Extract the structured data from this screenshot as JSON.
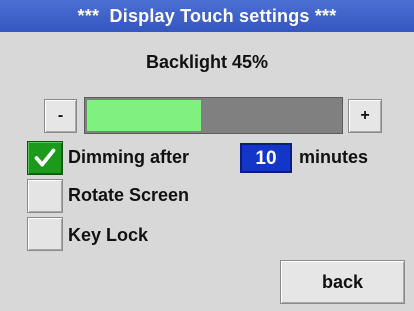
{
  "title": "***  Display Touch settings ***",
  "backlight": {
    "label": "Backlight 45%",
    "level_percent": 45,
    "minus_label": "-",
    "plus_label": "+"
  },
  "dimming": {
    "label": "Dimming after",
    "checked": true,
    "value": "10",
    "unit": "minutes"
  },
  "rotate": {
    "label": "Rotate Screen",
    "checked": false
  },
  "key_lock": {
    "label": "Key Lock",
    "checked": false
  },
  "back_label": "back",
  "colors": {
    "title_bar": "#3d5fc8",
    "slider_fill": "#80f080",
    "slider_track": "#808080",
    "checked_box": "#1c9a1c",
    "value_box": "#1436c8"
  },
  "icons": {
    "checkmark": "check-icon"
  }
}
